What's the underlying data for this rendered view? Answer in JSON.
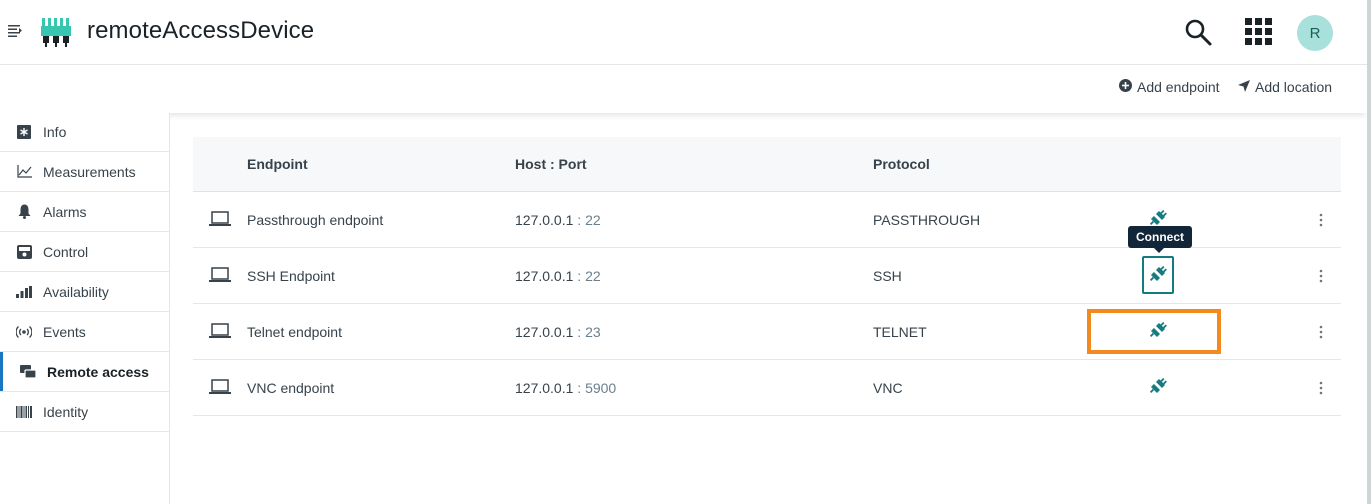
{
  "header": {
    "title": "remoteAccessDevice",
    "menu_icon": "menu-icon",
    "logo_icon": "device-icon",
    "search_icon": "search-icon",
    "apps_icon": "apps-grid-icon",
    "avatar_initial": "R",
    "avatar_color": "#a8e0dc"
  },
  "actions": {
    "add_endpoint": "Add endpoint",
    "add_location": "Add location"
  },
  "sidebar": {
    "items": [
      {
        "label": "Info",
        "icon": "info-icon",
        "active": false
      },
      {
        "label": "Measurements",
        "icon": "chart-icon",
        "active": false
      },
      {
        "label": "Alarms",
        "icon": "bell-icon",
        "active": false
      },
      {
        "label": "Control",
        "icon": "control-icon",
        "active": false
      },
      {
        "label": "Availability",
        "icon": "signal-bars-icon",
        "active": false
      },
      {
        "label": "Events",
        "icon": "broadcast-icon",
        "active": false
      },
      {
        "label": "Remote access",
        "icon": "remote-access-icon",
        "active": true
      },
      {
        "label": "Identity",
        "icon": "barcode-icon",
        "active": false
      }
    ]
  },
  "table": {
    "headers": {
      "endpoint": "Endpoint",
      "host_port": "Host : Port",
      "protocol": "Protocol"
    },
    "rows": [
      {
        "name": "Passthrough endpoint",
        "host": "127.0.0.1",
        "sep": " : ",
        "port": "22",
        "protocol": "PASSTHROUGH"
      },
      {
        "name": "SSH Endpoint",
        "host": "127.0.0.1",
        "sep": " : ",
        "port": "22",
        "protocol": "SSH"
      },
      {
        "name": "Telnet endpoint",
        "host": "127.0.0.1",
        "sep": " : ",
        "port": "23",
        "protocol": "TELNET"
      },
      {
        "name": "VNC endpoint",
        "host": "127.0.0.1",
        "sep": " : ",
        "port": "5900",
        "protocol": "VNC"
      }
    ]
  },
  "tooltip": {
    "text": "Connect"
  },
  "colors": {
    "accent": "#1776bf",
    "connect_icon": "#147b80",
    "highlight": "#f28a1e",
    "tooltip_bg": "#12263a"
  }
}
